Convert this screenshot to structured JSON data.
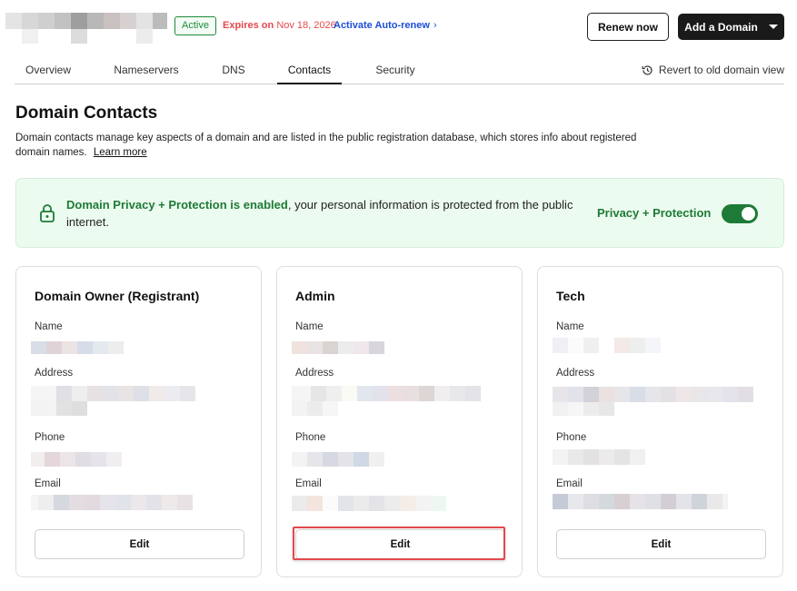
{
  "header": {
    "status_badge": "Active",
    "expires_label": "Expires on",
    "expires_date": "Nov 18, 2026",
    "auto_renew_label": "Activate Auto-renew",
    "renew_button": "Renew now",
    "add_domain_button": "Add a Domain"
  },
  "tabs": [
    {
      "label": "Overview",
      "active": false
    },
    {
      "label": "Nameservers",
      "active": false
    },
    {
      "label": "DNS",
      "active": false
    },
    {
      "label": "Contacts",
      "active": true
    },
    {
      "label": "Security",
      "active": false
    }
  ],
  "revert_link": "Revert to old domain view",
  "page": {
    "title": "Domain Contacts",
    "description": "Domain contacts manage key aspects of a domain and are listed in the public registration database, which stores info about registered domain names.",
    "learn_more": "Learn more"
  },
  "privacy": {
    "enabled_text": "Domain Privacy + Protection is enabled",
    "rest_text": ", your personal information is protected from the public internet.",
    "toggle_label": "Privacy + Protection",
    "toggle_on": true
  },
  "cards": [
    {
      "title": "Domain Owner (Registrant)",
      "labels": {
        "name": "Name",
        "address": "Address",
        "phone": "Phone",
        "email": "Email"
      },
      "edit": "Edit"
    },
    {
      "title": "Admin",
      "labels": {
        "name": "Name",
        "address": "Address",
        "phone": "Phone",
        "email": "Email"
      },
      "edit": "Edit"
    },
    {
      "title": "Tech",
      "labels": {
        "name": "Name",
        "address": "Address",
        "phone": "Phone",
        "email": "Email"
      },
      "edit": "Edit"
    }
  ],
  "colors": {
    "accent_green": "#1e7a37",
    "expires_red": "#e5484d",
    "link_blue": "#1d4ed8",
    "highlight_red": "#e5484d"
  }
}
